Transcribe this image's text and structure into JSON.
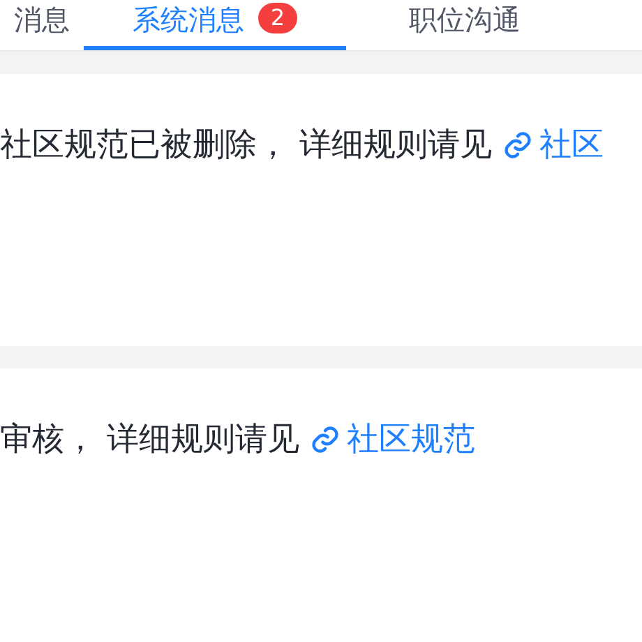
{
  "tabs": [
    {
      "label": "消息",
      "selected": false
    },
    {
      "label": "系统消息",
      "selected": true,
      "badge": "2"
    },
    {
      "label": "职位沟通",
      "selected": false
    }
  ],
  "messages": [
    {
      "text": "社区规范已被删除， 详细规则请见",
      "link": "社区"
    },
    {
      "text": "审核， 详细规则请见",
      "link": "社区规范"
    }
  ]
}
